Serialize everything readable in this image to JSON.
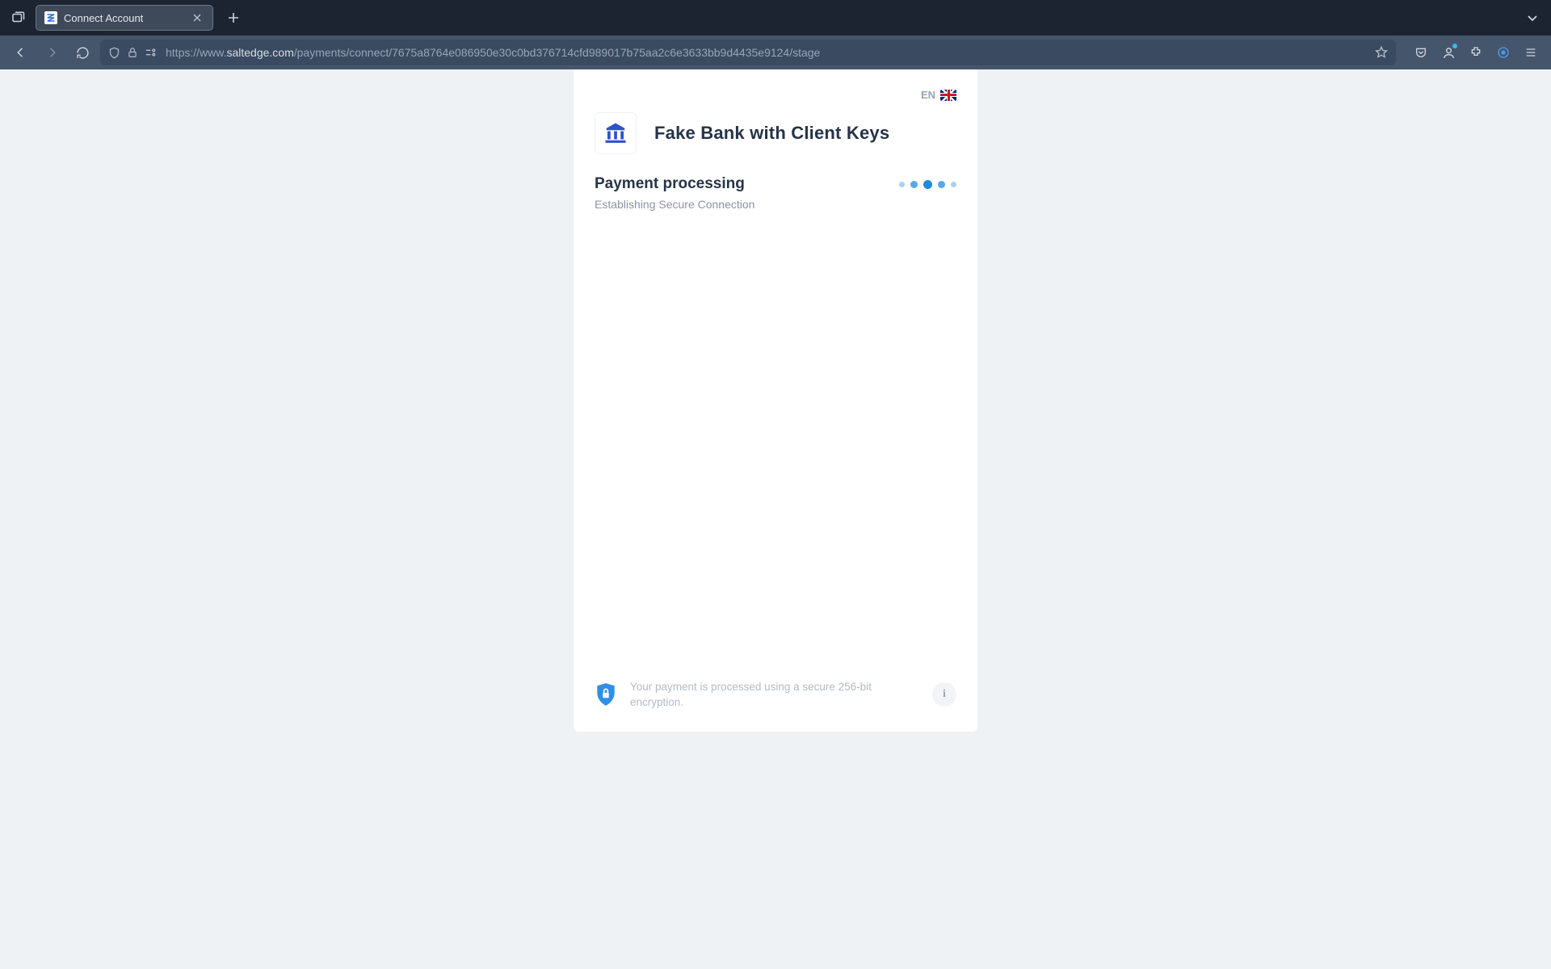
{
  "browser": {
    "tab_title": "Connect Account",
    "url": {
      "protocol": "https://www.",
      "domain": "saltedge.com",
      "path": "/payments/connect/7675a8764e086950e30c0bd376714cfd989017b75aa2c6e3633bb9d4435e9124/stage"
    }
  },
  "page": {
    "language": "EN",
    "bank_name": "Fake Bank with Client Keys",
    "status_title": "Payment processing",
    "status_subtitle": "Establishing Secure Connection",
    "footer_text": "Your payment is processed using a secure 256-bit encryption.",
    "info_label": "i"
  },
  "icons": {
    "app": "recent-windows-icon",
    "favicon": "saltedge-favicon",
    "close": "✕",
    "plus": "+"
  }
}
